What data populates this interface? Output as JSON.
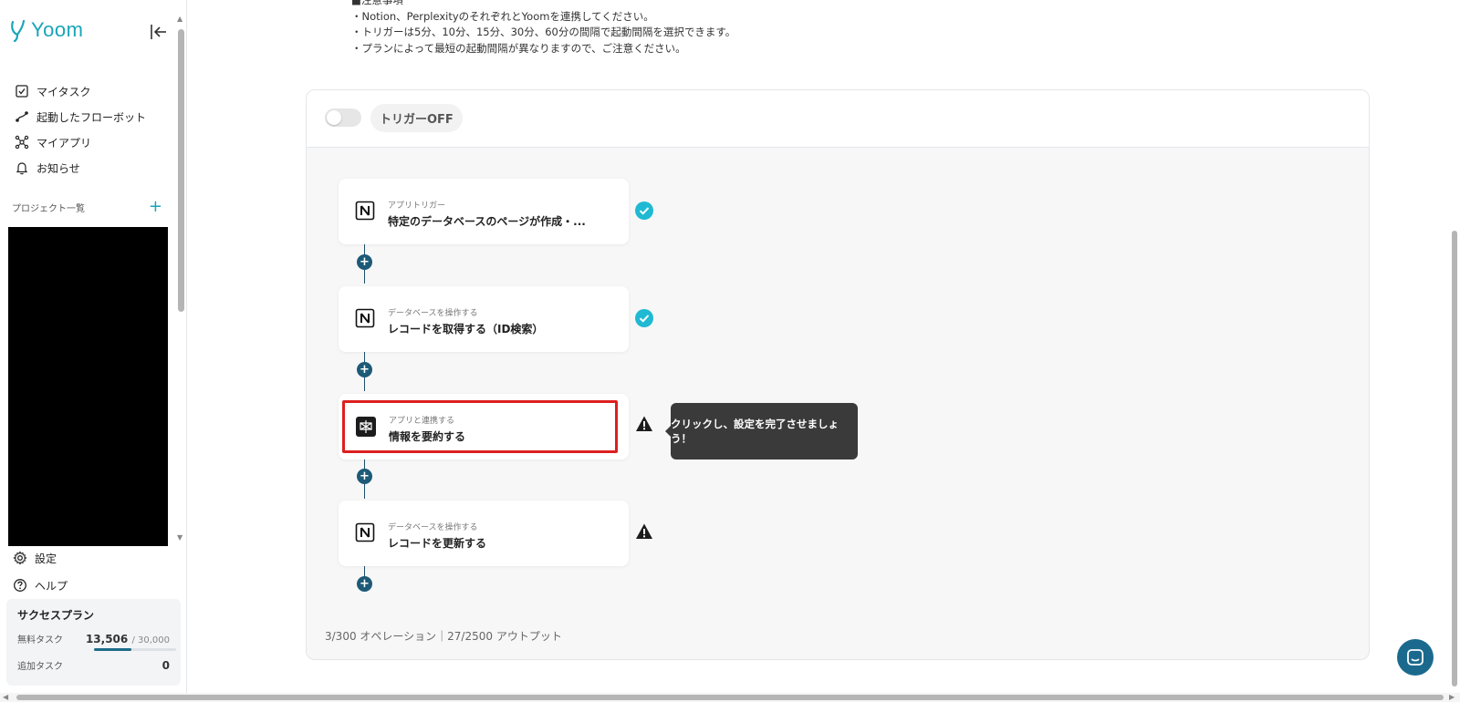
{
  "app": {
    "name": "Yoom"
  },
  "sidebar": {
    "nav": [
      {
        "label": "マイタスク",
        "icon": "checkbox-icon"
      },
      {
        "label": "起動したフローボット",
        "icon": "flow-icon"
      },
      {
        "label": "マイアプリ",
        "icon": "apps-icon"
      },
      {
        "label": "お知らせ",
        "icon": "bell-icon"
      }
    ],
    "projects_label": "プロジェクト一覧",
    "bottom_nav": [
      {
        "label": "設定",
        "icon": "gear-icon"
      },
      {
        "label": "ヘルプ",
        "icon": "help-icon"
      }
    ],
    "plan": {
      "title": "サクセスプラン",
      "free_tasks_label": "無料タスク",
      "free_tasks_used": "13,506",
      "free_tasks_total": "/ 30,000",
      "free_tasks_fraction": 0.45,
      "extra_tasks_label": "追加タスク",
      "extra_tasks_value": "0"
    }
  },
  "notes": {
    "heading": "■注意事項",
    "lines": [
      "・Notion、PerplexityのそれぞれとYoomを連携してください。",
      "・トリガーは5分、10分、15分、30分、60分の間隔で起動間隔を選択できます。",
      "・プランによって最短の起動間隔が異なりますので、ご注意ください。"
    ]
  },
  "flow": {
    "trigger_label": "トリガーOFF",
    "steps": [
      {
        "sub": "アプリトリガー",
        "title": "特定のデータベースのページが作成・...",
        "icon": "notion-icon",
        "status": "done"
      },
      {
        "sub": "データベースを操作する",
        "title": "レコードを取得する（ID検索）",
        "icon": "notion-icon",
        "status": "done"
      },
      {
        "sub": "アプリと連携する",
        "title": "情報を要約する",
        "icon": "perplexity-icon",
        "status": "warning"
      },
      {
        "sub": "データベースを操作する",
        "title": "レコードを更新する",
        "icon": "notion-icon",
        "status": "warning"
      }
    ],
    "tooltip": "クリックし、設定を完了させましょう！",
    "stats": "3/300 オペレーション｜27/2500 アウトプット"
  },
  "colors": {
    "accent": "#1aa5b8",
    "highlight": "#dd1f1f",
    "node": "#1d5a77"
  }
}
